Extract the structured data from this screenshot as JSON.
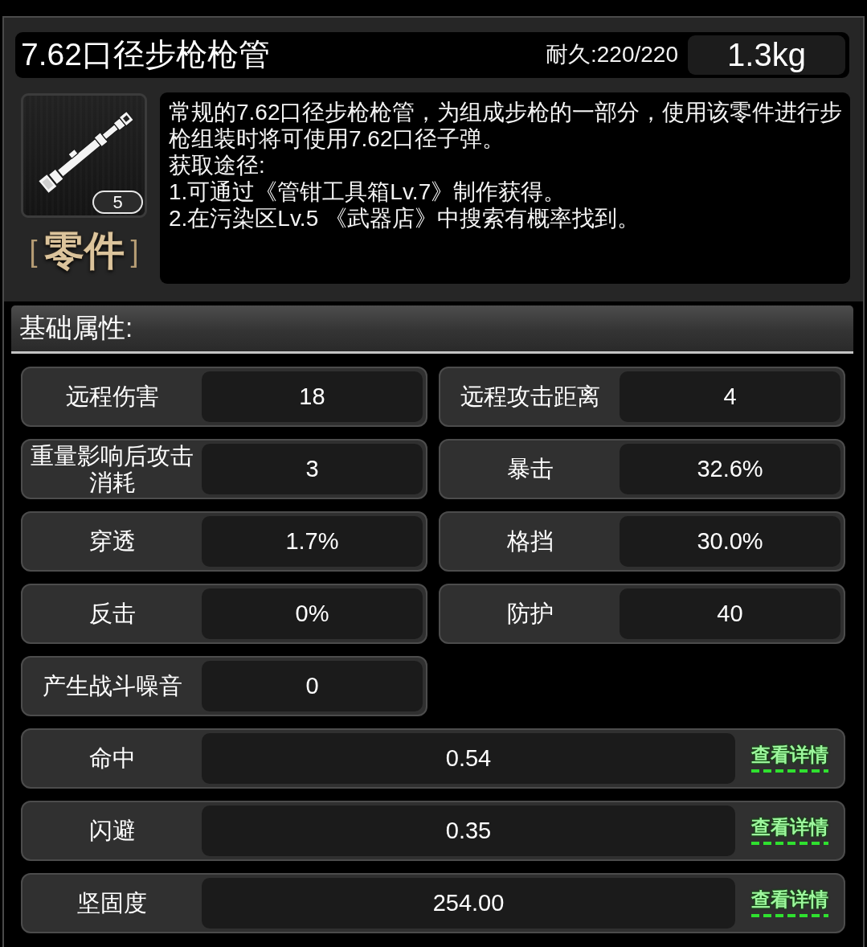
{
  "header": {
    "title": "7.62口径步枪枪管",
    "durability": "耐久:220/220",
    "weight": "1.3kg"
  },
  "item": {
    "count": "5",
    "category": {
      "open": "[",
      "name": "零件",
      "close": "]"
    },
    "description": [
      "常规的7.62口径步枪枪管，为组成步枪的一部分，使用该零件进行步枪组装时将可使用7.62口径子弹。",
      "获取途径:",
      "1.可通过《管钳工具箱Lv.7》制作获得。",
      "2.在污染区Lv.5 《武器店》中搜索有概率找到。"
    ]
  },
  "section": {
    "title": "基础属性:"
  },
  "attributes": [
    {
      "label": "远程伤害",
      "value": "18"
    },
    {
      "label": "远程攻击距离",
      "value": "4"
    },
    {
      "label": "重量影响后攻击消耗",
      "value": "3"
    },
    {
      "label": "暴击",
      "value": "32.6%"
    },
    {
      "label": "穿透",
      "value": "1.7%"
    },
    {
      "label": "格挡",
      "value": "30.0%"
    },
    {
      "label": "反击",
      "value": "0%"
    },
    {
      "label": "防护",
      "value": "40"
    },
    {
      "label": "产生战斗噪音",
      "value": "0"
    }
  ],
  "detailed_attributes": [
    {
      "label": "命中",
      "value": "0.54",
      "link": "查看详情"
    },
    {
      "label": "闪避",
      "value": "0.35",
      "link": "查看详情"
    },
    {
      "label": "坚固度",
      "value": "254.00",
      "link": "查看详情"
    }
  ]
}
